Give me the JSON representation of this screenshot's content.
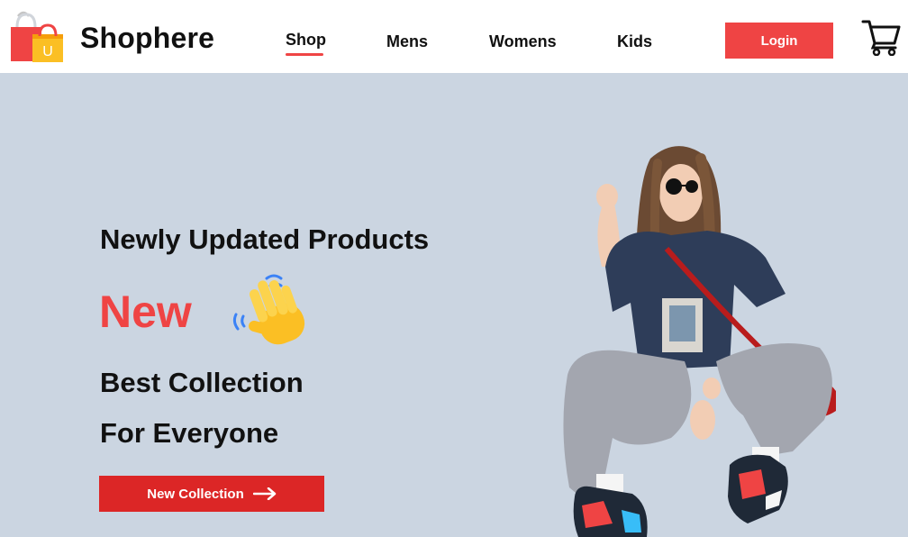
{
  "header": {
    "brand": "Shophere",
    "logo_letter": "U",
    "logo_icon": "shopping-bags-logo-icon",
    "nav": [
      {
        "label": "Shop",
        "active": true
      },
      {
        "label": "Mens",
        "active": false
      },
      {
        "label": "Womens",
        "active": false
      },
      {
        "label": "Kids",
        "active": false
      }
    ],
    "login_label": "Login",
    "cart_icon": "cart-icon"
  },
  "hero": {
    "subtitle": "Newly Updated Products",
    "highlight": "New",
    "wave_icon": "waving-hand-icon",
    "line1": "Best Collection",
    "line2": "For Everyone",
    "cta_label": "New Collection",
    "cta_icon": "arrow-right-icon",
    "image": "model-photo"
  },
  "colors": {
    "accent": "#ef4444",
    "cta": "#dc2626",
    "hero_bg": "#cbd5e1",
    "text": "#111111"
  }
}
